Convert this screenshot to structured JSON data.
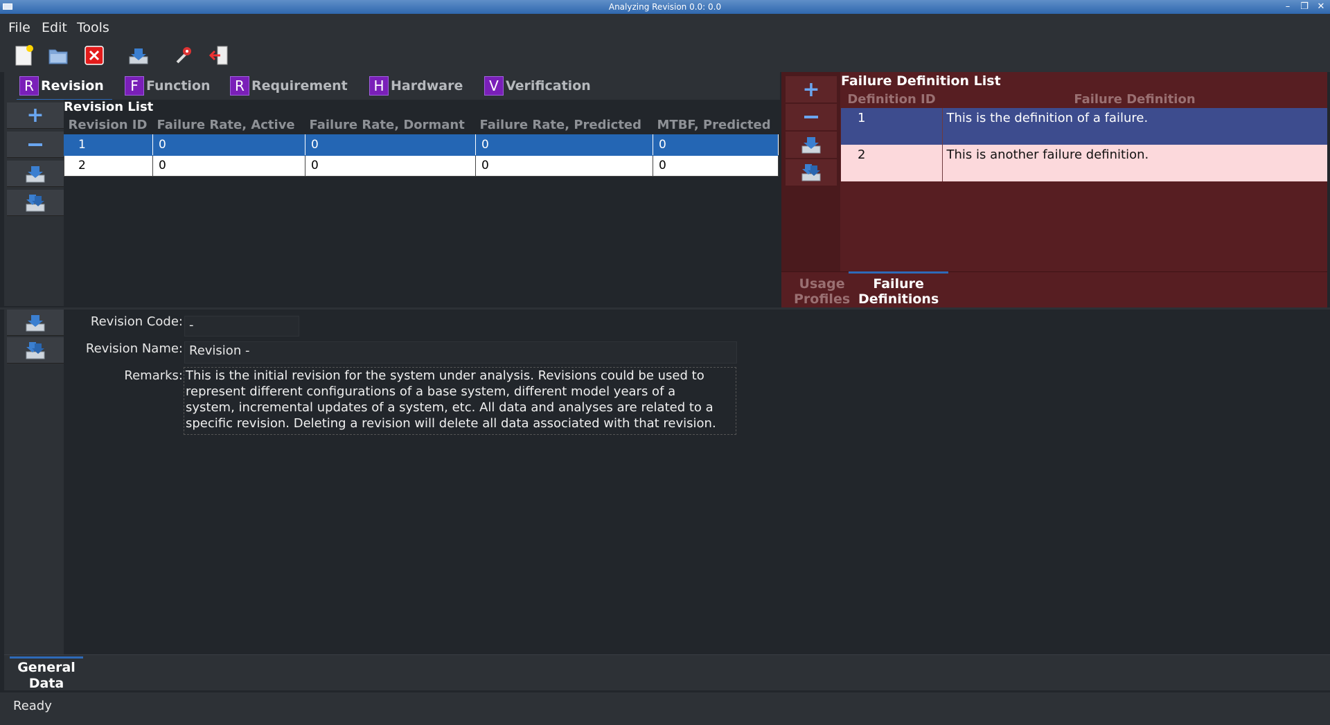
{
  "window": {
    "title": "Analyzing Revision 0.0: 0.0"
  },
  "menu": {
    "items": [
      "File",
      "Edit",
      "Tools"
    ]
  },
  "toolbar": {
    "buttons": [
      "new-document-icon",
      "open-folder-icon",
      "close-icon",
      "save-icon",
      "options-icon",
      "exit-icon"
    ]
  },
  "workbook_tabs": [
    {
      "badge": "R",
      "label": "Revision"
    },
    {
      "badge": "F",
      "label": "Function"
    },
    {
      "badge": "R",
      "label": "Requirement"
    },
    {
      "badge": "H",
      "label": "Hardware"
    },
    {
      "badge": "V",
      "label": "Verification"
    }
  ],
  "revision_list": {
    "title": "Revision List",
    "columns": [
      "Revision ID",
      "Failure Rate, Active",
      "Failure Rate, Dormant",
      "Failure Rate, Predicted",
      "MTBF, Predicted"
    ],
    "rows": [
      [
        "1",
        "0",
        "0",
        "0",
        "0"
      ],
      [
        "2",
        "0",
        "0",
        "0",
        "0"
      ]
    ],
    "selected_row": 0
  },
  "failure_definitions": {
    "title": "Failure Definition List",
    "columns": [
      "Definition ID",
      "Failure Definition"
    ],
    "rows": [
      [
        "1",
        "This is the definition of a failure."
      ],
      [
        "2",
        "This is another failure definition."
      ]
    ],
    "tabs": [
      {
        "line1": "Usage",
        "line2": "Profiles"
      },
      {
        "line1": "Failure",
        "line2": "Definitions"
      }
    ]
  },
  "general_data": {
    "revision_code_label": "Revision Code:",
    "revision_code": "-",
    "revision_name_label": "Revision Name:",
    "revision_name": "Revision -",
    "remarks_label": "Remarks:",
    "remarks_lines": [
      "This is the initial revision for the system under analysis.  Revisions could be used to",
      "represent different configurations of a base system, different model years of a",
      "system, incremental updates of a system, etc.  All data and analyses are related to a",
      "specific revision.  Deleting a revision will delete all data associated with that revision."
    ],
    "tab": {
      "line1": "General",
      "line2": "Data"
    }
  },
  "status": {
    "text": "Ready"
  },
  "colors": {
    "accent": "#2466b4",
    "panel_red": "#571e22",
    "badge_purple": "#7a1fb8"
  }
}
